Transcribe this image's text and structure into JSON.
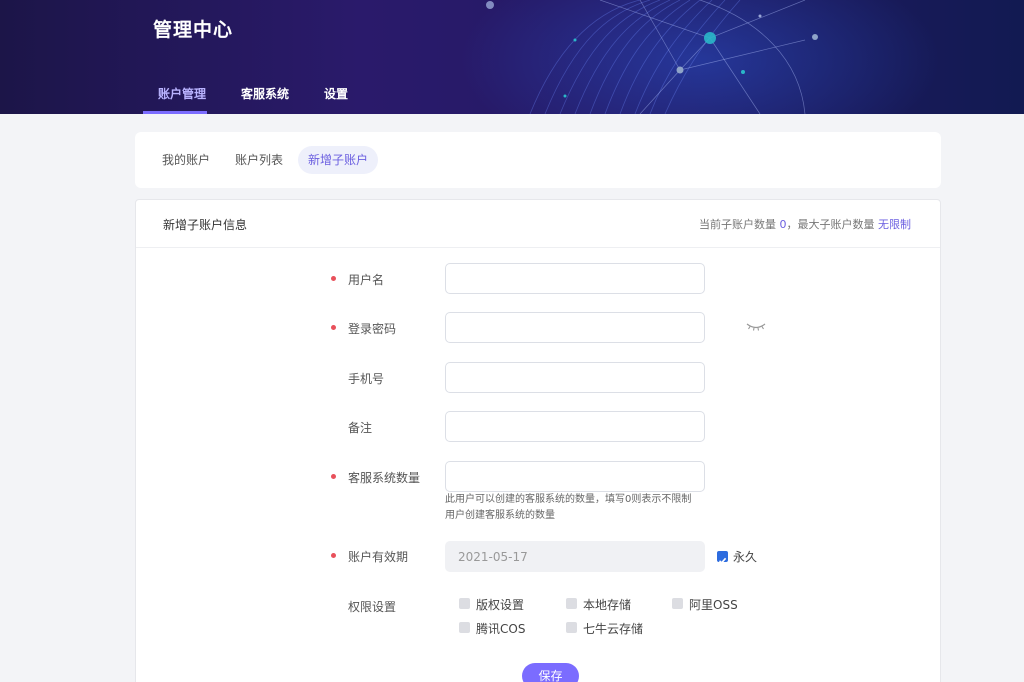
{
  "brand": {
    "title": "管理中心"
  },
  "nav": {
    "tabs": [
      {
        "label": "账户管理",
        "active": true
      },
      {
        "label": "客服系统",
        "active": false
      },
      {
        "label": "设置",
        "active": false
      }
    ]
  },
  "subnav": {
    "tabs": [
      {
        "label": "我的账户",
        "active": false
      },
      {
        "label": "账户列表",
        "active": false
      },
      {
        "label": "新增子账户",
        "active": true
      }
    ]
  },
  "card": {
    "title": "新增子账户信息",
    "stat_prefix": "当前子账户数量",
    "stat_count": "0",
    "stat_mid": "，最大子账户数量",
    "stat_max": "无限制"
  },
  "form": {
    "username": {
      "label": "用户名",
      "required": true,
      "value": "",
      "placeholder": ""
    },
    "password": {
      "label": "登录密码",
      "required": true,
      "value": "",
      "placeholder": "",
      "toggle_icon": "eye-closed-icon"
    },
    "phone": {
      "label": "手机号",
      "required": false,
      "value": "",
      "placeholder": ""
    },
    "remark": {
      "label": "备注",
      "required": false,
      "value": "",
      "placeholder": ""
    },
    "cs_count": {
      "label": "客服系统数量",
      "required": true,
      "value": "",
      "placeholder": "",
      "hint_line1": "此用户可以创建的客服系统的数量，填写0则表示不限制",
      "hint_line2": "用户创建客服系统的数量"
    },
    "validity": {
      "label": "账户有效期",
      "required": true,
      "value": "2021-05-17",
      "forever_label": "永久",
      "forever_checked": true
    },
    "permissions": {
      "label": "权限设置",
      "options": [
        {
          "label": "版权设置",
          "checked": false
        },
        {
          "label": "本地存储",
          "checked": false
        },
        {
          "label": "阿里OSS",
          "checked": false
        },
        {
          "label": "腾讯COS",
          "checked": false
        },
        {
          "label": "七牛云存储",
          "checked": false
        }
      ]
    },
    "save_label": "保存"
  },
  "colors": {
    "accent": "#7b6cff",
    "required": "#e8505b",
    "checkbox_checked": "#2d6cdf",
    "header_bg": "#221860"
  }
}
